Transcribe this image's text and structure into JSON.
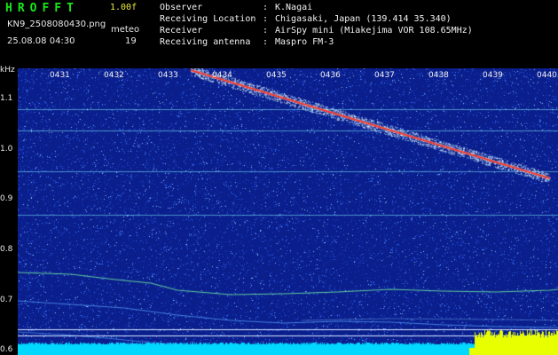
{
  "header": {
    "app_title": "HROFFT",
    "app_version": "1.00f",
    "file_name": "KN9_2508080430.png",
    "timestamp": "25.08.08 04:30",
    "meteor_label": "meteo",
    "meteor_count": "19"
  },
  "info": {
    "observer": {
      "label": "Observer",
      "value": "K.Nagai"
    },
    "location": {
      "label": "Receiving Location",
      "value": "Chigasaki, Japan (139.414 35.340)"
    },
    "receiver": {
      "label": "Receiver",
      "value": "AirSpy mini (Miakejima VOR 108.65MHz)"
    },
    "antenna": {
      "label": "Receiving antenna",
      "value": "Maspro FM-3"
    }
  },
  "spectrogram": {
    "freq_unit": "kHz",
    "freq_labels": [
      {
        "text": "1.1",
        "value": 1.1
      },
      {
        "text": "1.0",
        "value": 1.0
      },
      {
        "text": "0.9",
        "value": 0.9
      },
      {
        "text": "0.8",
        "value": 0.8
      },
      {
        "text": "0.7",
        "value": 0.7
      },
      {
        "text": "0.6",
        "value": 0.6
      }
    ],
    "time_labels": [
      "0431",
      "0432",
      "0433",
      "0434",
      "0435",
      "0436",
      "0437",
      "0438",
      "0439",
      "0440"
    ],
    "colors": {
      "background": "#0a1e8c",
      "noise": "#3c78ff",
      "echo_core": "#ff3020",
      "carrier": "#7ff0ff",
      "level": "#e8ff00",
      "baseline": "#00d8ff"
    }
  }
}
